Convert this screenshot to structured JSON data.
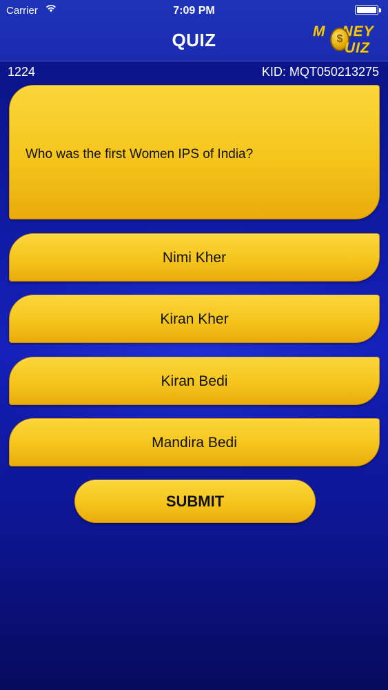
{
  "status_bar": {
    "carrier": "Carrier",
    "time": "7:09 PM"
  },
  "header": {
    "title": "QUIZ",
    "logo_line1": "NEY",
    "logo_line2": "UIZ",
    "logo_prefix": "M",
    "logo_coin_symbol": "$"
  },
  "info": {
    "count": "1224",
    "kid": "KID: MQT050213275"
  },
  "question": {
    "text": "Who was the first Women IPS of India?"
  },
  "options": [
    {
      "label": "Nimi Kher"
    },
    {
      "label": "Kiran Kher"
    },
    {
      "label": "Kiran Bedi"
    },
    {
      "label": "Mandira Bedi"
    }
  ],
  "submit": {
    "label": "SUBMIT"
  },
  "colors": {
    "accent": "#f5c51d",
    "background": "#0b1488",
    "header": "#1a2cb0"
  }
}
